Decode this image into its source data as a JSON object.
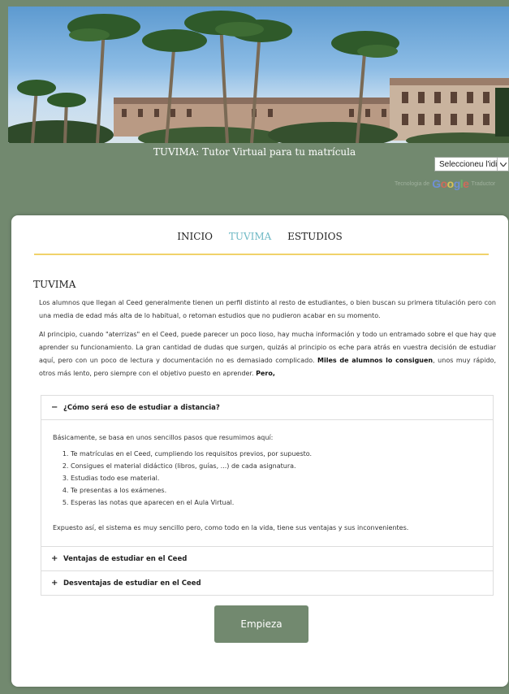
{
  "header": {
    "site_title": "TUVIMA: Tutor Virtual para tu matrícula",
    "language_select_value": "Seleccioneu l'idioma",
    "translate_prefix": "Tecnologia de",
    "translate_brand": "Google",
    "translate_suffix": "Traductor"
  },
  "nav": {
    "items": [
      "INICIO",
      "TUVIMA",
      "ESTUDIOS"
    ],
    "active": "TUVIMA"
  },
  "main": {
    "heading": "TUVIMA",
    "para1": "Los alumnos que llegan al Ceed generalmente tienen un perfil distinto al resto de estudiantes, o bien buscan su primera titulación pero con una media de edad más alta de lo habitual, o retoman estudios que no pudieron acabar en su momento.",
    "para2_text": "Al principio, cuando \"aterrizas\" en el Ceed, puede parecer un poco lioso, hay mucha información y todo un entramado sobre el que hay que aprender su funcionamiento. La gran cantidad de dudas que surgen, quizás al principio os eche para atrás en vuestra decisión de estudiar aquí, pero con un poco de lectura y documentación no es demasiado complicado. ",
    "para2_bold1": "Miles de alumnos lo consiguen",
    "para2_text2": ", unos muy rápido, otros más lento, pero siempre con el objetivo puesto en aprender. ",
    "para2_bold2": "Pero,"
  },
  "accordion": {
    "panels": [
      {
        "symbol": "−",
        "title": "¿Cómo será eso de estudiar a distancia?",
        "intro": "Básicamente, se basa en unos sencillos pasos que resumimos aquí:",
        "steps": [
          "Te matrículas en el Ceed, cumpliendo los requisitos previos, por supuesto.",
          "Consigues el material didáctico (libros, guías, ...) de cada asignatura.",
          "Estudias todo ese material.",
          "Te presentas a los exámenes.",
          "Esperas las notas que aparecen en el Aula Virtual."
        ],
        "outro": "Expuesto así, el sistema es muy sencillo pero, como todo en la vida, tiene sus ventajas y sus inconvenientes."
      },
      {
        "symbol": "+",
        "title": "Ventajas de estudiar en el Ceed"
      },
      {
        "symbol": "+",
        "title": "Desventajas de estudiar en el Ceed"
      }
    ]
  },
  "start_button": "Empieza",
  "colors": {
    "background": "#72896f",
    "nav_active": "#6fb9c5",
    "nav_underline": "#f0d26a",
    "button": "#72896f"
  }
}
